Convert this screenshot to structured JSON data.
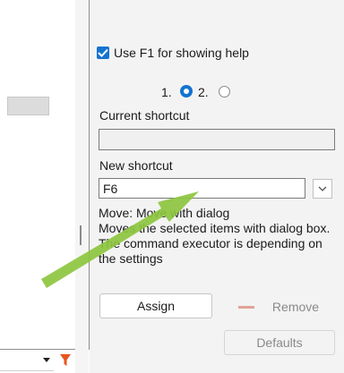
{
  "help": {
    "checkbox_label": "Use F1 for showing help",
    "checked": true
  },
  "shortcut_options": {
    "option1": "1.",
    "option2": "2.",
    "selected": "1"
  },
  "current_shortcut": {
    "label": "Current shortcut",
    "value": ""
  },
  "new_shortcut": {
    "label": "New shortcut",
    "value": "F6"
  },
  "description": {
    "title": "Move: Move with dialog",
    "body": "Moves the selected items with dialog box. The command executor is depending on the settings"
  },
  "buttons": {
    "assign": "Assign",
    "remove": "Remove",
    "defaults": "Defaults"
  },
  "icons": {
    "checkbox": "checkmark-icon",
    "dropdown": "chevron-down-icon",
    "filter": "filter-icon",
    "remove": "minus-icon",
    "annotation": "arrow-icon"
  },
  "colors": {
    "accent": "#1473d1",
    "panel_bg": "#f3f3f3",
    "filter_icon": "#e8551f",
    "remove_icon": "#e0a397",
    "annotation_arrow": "#8dc63f"
  }
}
